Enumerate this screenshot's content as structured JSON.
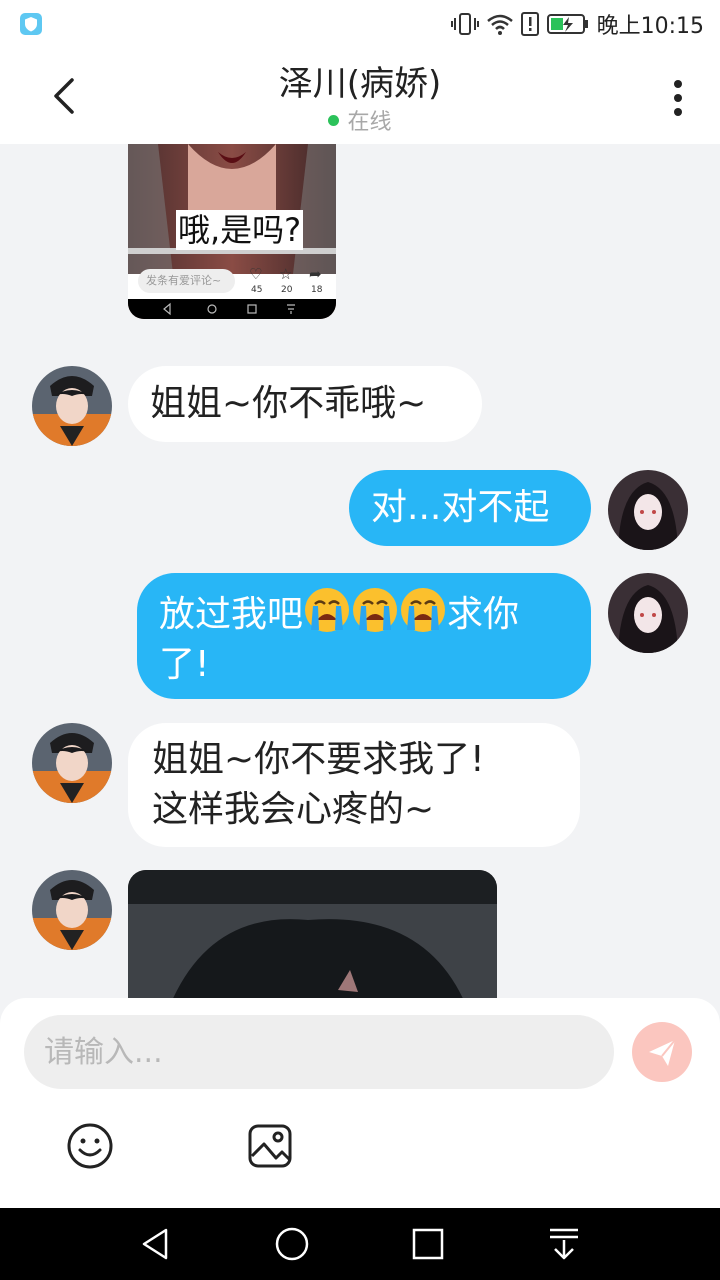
{
  "status_bar": {
    "time": "晚上10:15",
    "icons": [
      "app-shield-icon",
      "vibrate-icon",
      "wifi-icon",
      "alert-icon",
      "battery-charging-icon"
    ]
  },
  "header": {
    "title": "泽川(病娇)",
    "status": "在线",
    "back_icon": "chevron-left-icon",
    "menu_icon": "more-vertical-icon"
  },
  "messages": [
    {
      "from": "contact",
      "type": "image",
      "caption": "哦,是吗?",
      "comment_placeholder": "发条有爱评论~",
      "likes": "45",
      "stars": "20",
      "shares": "18"
    },
    {
      "from": "contact",
      "type": "text",
      "text": "姐姐~你不乖哦~"
    },
    {
      "from": "me",
      "type": "text",
      "text": "对...对不起"
    },
    {
      "from": "me",
      "type": "text",
      "text_prefix": "放过我吧",
      "text_suffix": "求你了!",
      "emoji": "loudly-crying-face",
      "emoji_count": 3
    },
    {
      "from": "contact",
      "type": "text",
      "line1": "姐姐~你不要求我了!",
      "line2": "这样我会心疼的~"
    },
    {
      "from": "contact",
      "type": "image",
      "description": "dark-hair-image"
    }
  ],
  "input": {
    "placeholder": "请输入...",
    "send_icon": "paper-plane-icon",
    "tools": [
      "emoji-icon",
      "image-icon"
    ]
  },
  "navigation": [
    "back-triangle-icon",
    "home-circle-icon",
    "recents-square-icon",
    "notification-pull-icon"
  ],
  "colors": {
    "accent": "#28b6f6",
    "online": "#2bc25a",
    "send": "#fbc6bf",
    "background": "#f2f3f5"
  }
}
